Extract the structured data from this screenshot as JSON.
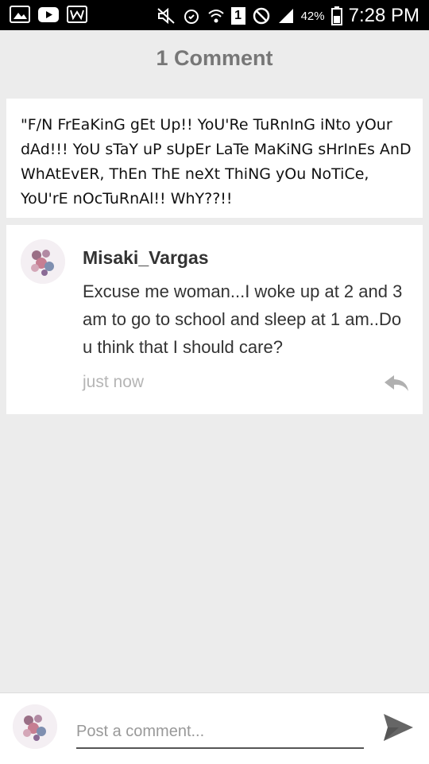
{
  "status_bar": {
    "battery": "42%",
    "sim": "1",
    "time": "7:28 PM"
  },
  "header": {
    "title": "1 Comment"
  },
  "post": {
    "text": "\"F/N FrEaKinG gEt Up!! YoU'Re TuRnInG iNto yOur dAd!!! YoU sTaY uP sUpEr LaTe MaKiNG sHrInEs AnD WhAtEvER, ThEn ThE neXt ThiNG yOu NoTiCe, YoU'rE nOcTuRnAl!! WhY??!!"
  },
  "comment": {
    "author": "Misaki_Vargas",
    "body": "Excuse me woman...I woke up at 2 and 3 am to go to school and sleep at 1 am..Do u think that I should care?",
    "timestamp": "just now"
  },
  "composer": {
    "placeholder": "Post a comment..."
  },
  "icons": {
    "reply": "reply-arrow-icon",
    "send": "send-icon"
  }
}
